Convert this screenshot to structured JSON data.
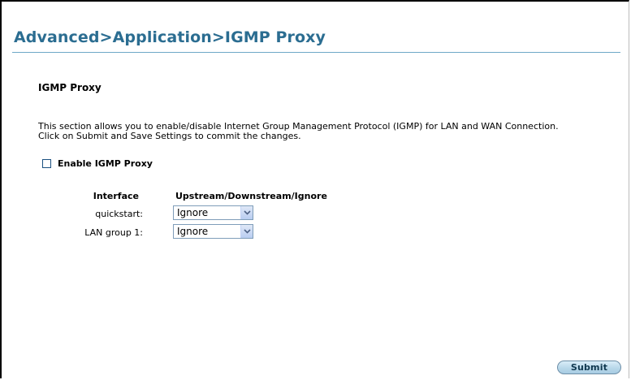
{
  "page": {
    "title": "Advanced>Application>IGMP Proxy",
    "title_color": "#2b6d91"
  },
  "section": {
    "heading": "IGMP Proxy",
    "description_line1": "This section allows you to enable/disable Internet Group Management Protocol (IGMP) for LAN and WAN Connection.",
    "description_line2": "Click on Submit and Save Settings to commit the changes."
  },
  "enable": {
    "label": "Enable IGMP Proxy",
    "checked": false
  },
  "table": {
    "col_interface": "Interface",
    "col_mode": "Upstream/Downstream/Ignore",
    "rows": [
      {
        "interface": "quickstart:",
        "mode": "Ignore"
      },
      {
        "interface": "LAN group 1:",
        "mode": "Ignore"
      }
    ]
  },
  "actions": {
    "submit_label": "Submit",
    "button_color": "#b9d8ea"
  },
  "icons": {
    "dropdown": "chevron-down-icon",
    "checkbox": "checkbox-icon"
  }
}
